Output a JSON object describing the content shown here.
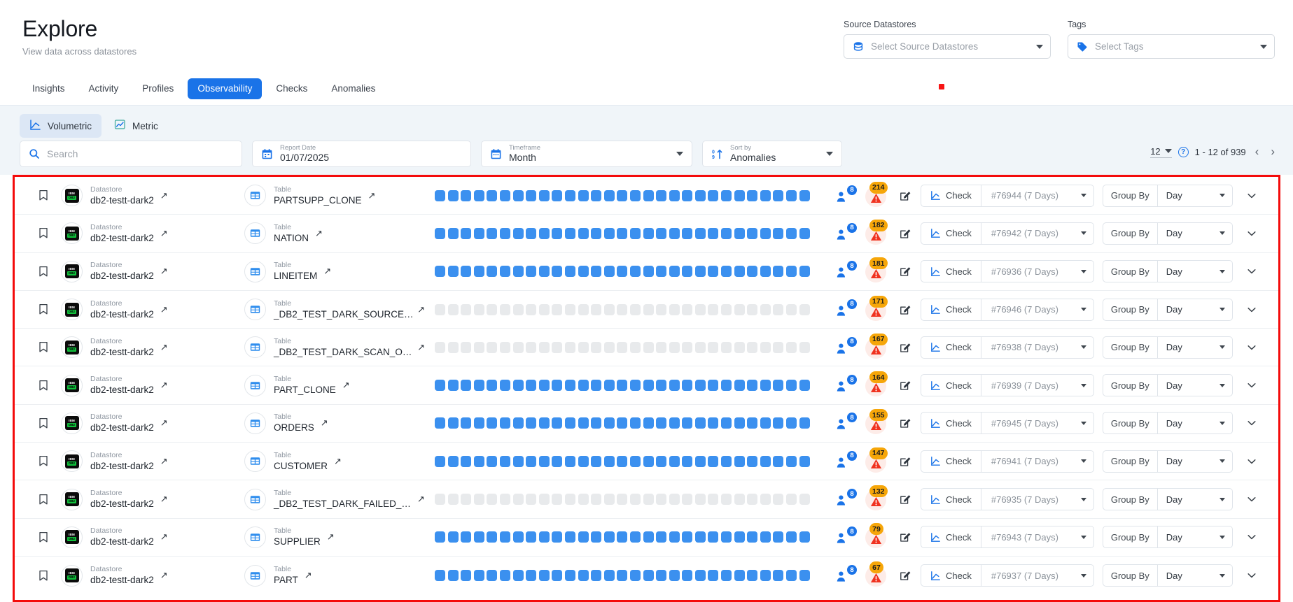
{
  "header": {
    "title": "Explore",
    "subtitle": "View data across datastores",
    "source_datastores": {
      "label": "Source Datastores",
      "placeholder": "Select Source Datastores",
      "icon": "database-icon"
    },
    "tags": {
      "label": "Tags",
      "placeholder": "Select Tags",
      "icon": "tag-icon"
    }
  },
  "tabs": [
    {
      "label": "Insights",
      "active": false
    },
    {
      "label": "Activity",
      "active": false
    },
    {
      "label": "Profiles",
      "active": false
    },
    {
      "label": "Observability",
      "active": true
    },
    {
      "label": "Checks",
      "active": false
    },
    {
      "label": "Anomalies",
      "active": false
    }
  ],
  "modes": [
    {
      "label": "Volumetric",
      "active": true,
      "icon": "line-chart-icon"
    },
    {
      "label": "Metric",
      "active": false,
      "icon": "metric-chart-icon"
    }
  ],
  "filters": {
    "search": {
      "placeholder": "Search",
      "value": "",
      "icon": "search-icon"
    },
    "report_date": {
      "label": "Report Date",
      "value": "01/07/2025",
      "icon": "calendar-icon"
    },
    "timeframe": {
      "label": "Timeframe",
      "value": "Month",
      "icon": "calendar-range-icon"
    },
    "sort_by": {
      "label": "Sort by",
      "value": "Anomalies",
      "icon": "sort-icon"
    }
  },
  "pagination": {
    "page_size": "12",
    "range": "1 - 12 of 939",
    "prev": "‹",
    "next": "›",
    "help_icon": "help-circle-icon"
  },
  "colors": {
    "accent": "#1a73e8",
    "spark_on": "#3b90ef",
    "spark_off": "#e8eaec",
    "warn_badge": "#f6a609",
    "frame": "#f40b0b",
    "subbar_bg": "#f0f5f9"
  },
  "row_labels": {
    "datastore_caption": "Datastore",
    "table_caption": "Table",
    "check_label": "Check",
    "group_by_label": "Group By"
  },
  "rows": [
    {
      "datastore": "db2-testt-dark2",
      "table": "PARTSUPP_CLONE",
      "users": "8",
      "anomalies": "214",
      "check_id": "#76944 (7 Days)",
      "group_by": "Day",
      "active": true
    },
    {
      "datastore": "db2-testt-dark2",
      "table": "NATION",
      "users": "8",
      "anomalies": "182",
      "check_id": "#76942 (7 Days)",
      "group_by": "Day",
      "active": true
    },
    {
      "datastore": "db2-testt-dark2",
      "table": "LINEITEM",
      "users": "8",
      "anomalies": "181",
      "check_id": "#76936 (7 Days)",
      "group_by": "Day",
      "active": true
    },
    {
      "datastore": "db2-testt-dark2",
      "table": "_DB2_TEST_DARK_SOURCE…",
      "users": "8",
      "anomalies": "171",
      "check_id": "#76946 (7 Days)",
      "group_by": "Day",
      "active": false
    },
    {
      "datastore": "db2-testt-dark2",
      "table": "_DB2_TEST_DARK_SCAN_O…",
      "users": "8",
      "anomalies": "167",
      "check_id": "#76938 (7 Days)",
      "group_by": "Day",
      "active": false
    },
    {
      "datastore": "db2-testt-dark2",
      "table": "PART_CLONE",
      "users": "8",
      "anomalies": "164",
      "check_id": "#76939 (7 Days)",
      "group_by": "Day",
      "active": true
    },
    {
      "datastore": "db2-testt-dark2",
      "table": "ORDERS",
      "users": "8",
      "anomalies": "155",
      "check_id": "#76945 (7 Days)",
      "group_by": "Day",
      "active": true
    },
    {
      "datastore": "db2-testt-dark2",
      "table": "CUSTOMER",
      "users": "8",
      "anomalies": "147",
      "check_id": "#76941 (7 Days)",
      "group_by": "Day",
      "active": true
    },
    {
      "datastore": "db2-testt-dark2",
      "table": "_DB2_TEST_DARK_FAILED_…",
      "users": "8",
      "anomalies": "132",
      "check_id": "#76935 (7 Days)",
      "group_by": "Day",
      "active": false
    },
    {
      "datastore": "db2-testt-dark2",
      "table": "SUPPLIER",
      "users": "8",
      "anomalies": "79",
      "check_id": "#76943 (7 Days)",
      "group_by": "Day",
      "active": true
    },
    {
      "datastore": "db2-testt-dark2",
      "table": "PART",
      "users": "8",
      "anomalies": "67",
      "check_id": "#76937 (7 Days)",
      "group_by": "Day",
      "active": true
    }
  ],
  "sparkline": {
    "cells_per_row": 29
  }
}
